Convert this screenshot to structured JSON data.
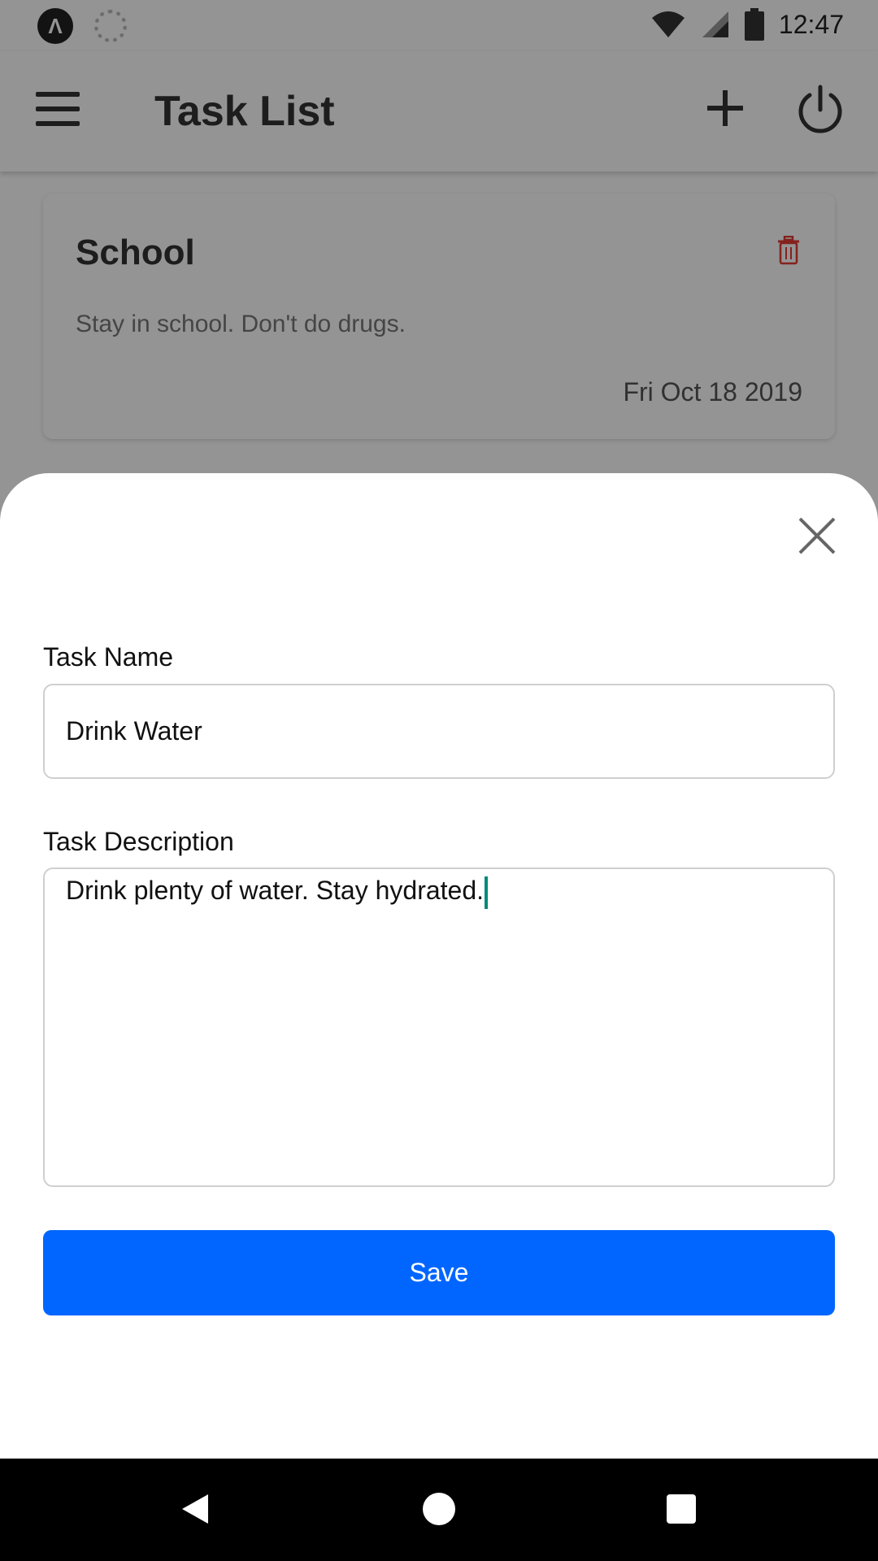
{
  "status_bar": {
    "time": "12:47"
  },
  "toolbar": {
    "title": "Task List"
  },
  "task_card": {
    "title": "School",
    "description": "Stay in school. Don't do drugs.",
    "date": "Fri Oct 18 2019"
  },
  "sheet": {
    "task_name_label": "Task Name",
    "task_name_value": "Drink Water",
    "task_description_label": "Task Description",
    "task_description_value": "Drink plenty of water. Stay hydrated.",
    "save_label": "Save"
  },
  "colors": {
    "primary": "#0066ff",
    "caret": "#00897b",
    "trash": "#e53935",
    "overlay": "rgba(0,0,0,0.42)"
  },
  "icons": [
    "app-launcher-icon",
    "sync-icon",
    "wifi-icon",
    "signal-icon",
    "battery-icon",
    "menu-icon",
    "add-icon",
    "power-icon",
    "trash-icon",
    "close-icon",
    "back-icon",
    "home-icon",
    "recents-icon"
  ]
}
